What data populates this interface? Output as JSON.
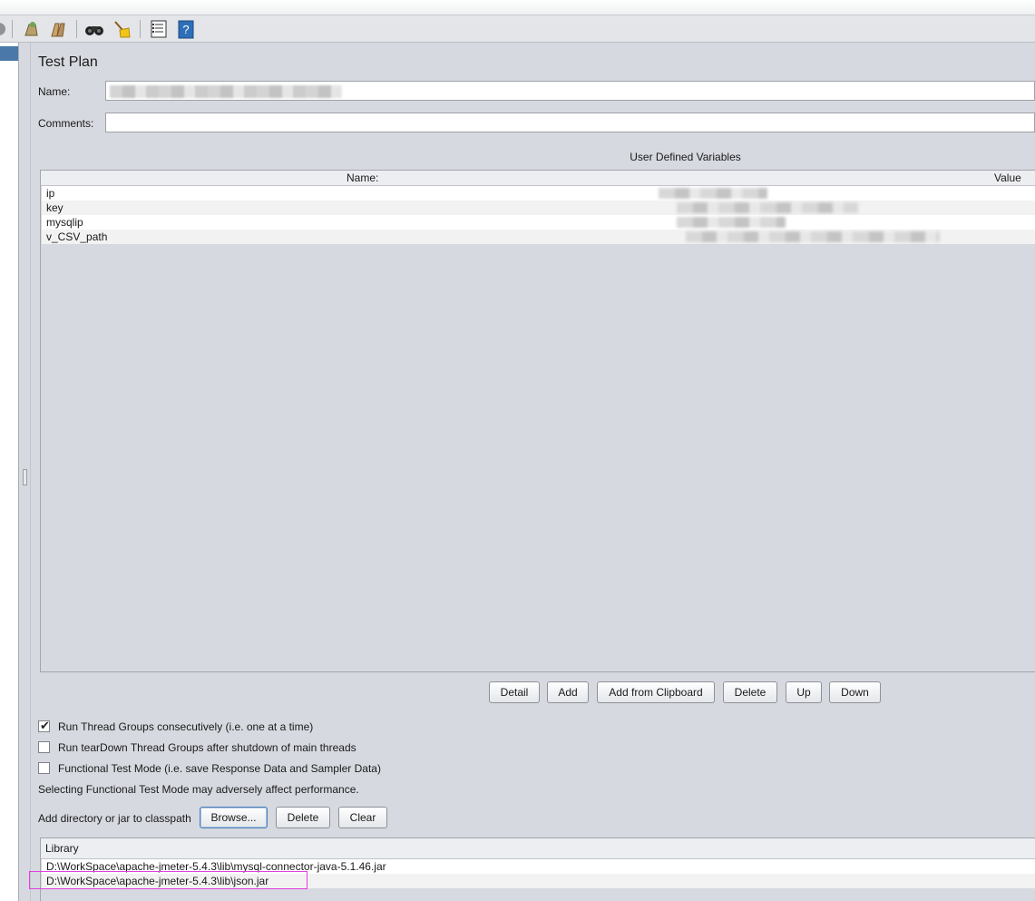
{
  "toolbar": {
    "icons": [
      "clear-icon",
      "clear-all-icon",
      "search-binoculars-icon",
      "reset-search-broom-icon",
      "function-helper-icon",
      "help-icon"
    ]
  },
  "test_plan": {
    "title": "Test Plan",
    "name_label": "Name:",
    "comments_label": "Comments:",
    "comments_value": ""
  },
  "udv": {
    "title": "User Defined Variables",
    "col_name": "Name:",
    "col_value": "Value",
    "rows": [
      {
        "name": "ip"
      },
      {
        "name": "key"
      },
      {
        "name": "mysqlip"
      },
      {
        "name": "v_CSV_path"
      }
    ],
    "buttons": {
      "detail": "Detail",
      "add": "Add",
      "add_clipboard": "Add from Clipboard",
      "delete": "Delete",
      "up": "Up",
      "down": "Down"
    }
  },
  "options": {
    "run_consecutively": "Run Thread Groups consecutively (i.e. one at a time)",
    "run_consecutively_checked": true,
    "run_teardown": "Run tearDown Thread Groups after shutdown of main threads",
    "run_teardown_checked": false,
    "functional_mode": "Functional Test Mode (i.e. save Response Data and Sampler Data)",
    "functional_mode_checked": false,
    "functional_note": "Selecting Functional Test Mode may adversely affect performance."
  },
  "classpath": {
    "label": "Add directory or jar to classpath",
    "browse": "Browse...",
    "delete": "Delete",
    "clear": "Clear",
    "col_library": "Library",
    "rows": [
      "D:\\WorkSpace\\apache-jmeter-5.4.3\\lib\\mysql-connector-java-5.1.46.jar",
      "D:\\WorkSpace\\apache-jmeter-5.4.3\\lib\\json.jar"
    ]
  }
}
